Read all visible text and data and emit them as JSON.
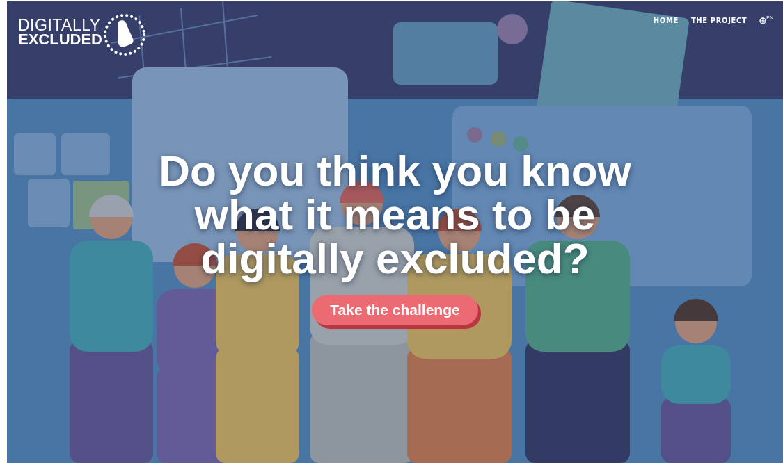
{
  "logo": {
    "lines": [
      "DIGITALLY",
      "EXCLUDED"
    ]
  },
  "nav": {
    "items": [
      {
        "label": "HOME"
      },
      {
        "label": "THE PROJECT"
      }
    ],
    "language": "EN"
  },
  "hero": {
    "headline": "Do you think you know what it means to be digitally excluded?",
    "button": "Take the challenge"
  }
}
